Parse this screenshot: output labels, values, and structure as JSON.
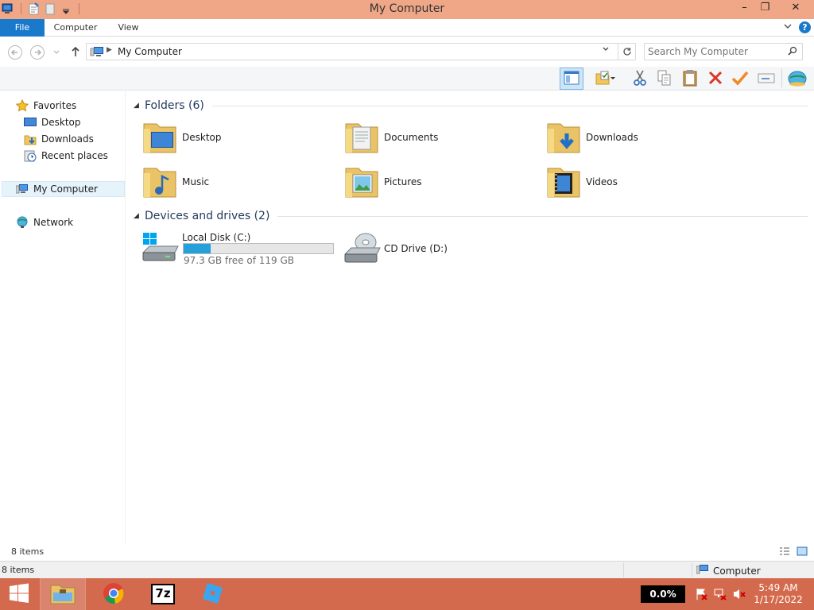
{
  "window": {
    "title": "My Computer",
    "controls": {
      "minimize": "–",
      "maximize": "❐",
      "close": "✕"
    }
  },
  "ribbon": {
    "tabs": [
      {
        "label": "File",
        "active": true
      },
      {
        "label": "Computer"
      },
      {
        "label": "View"
      }
    ],
    "help": "?"
  },
  "address": {
    "path": "My Computer",
    "search_placeholder": "Search My Computer"
  },
  "toolbar": {
    "buttons": [
      "layout-pane-icon",
      "properties-icon",
      "cut-icon",
      "copy-icon",
      "paste-icon",
      "delete-icon",
      "check-icon",
      "rename-icon",
      "network-globe-icon"
    ]
  },
  "nav": {
    "favorites": "Favorites",
    "items": [
      {
        "label": "Desktop",
        "icon": "desktop-icon"
      },
      {
        "label": "Downloads",
        "icon": "downloads-icon"
      },
      {
        "label": "Recent places",
        "icon": "recent-places-icon"
      }
    ],
    "computer": "My Computer",
    "network": "Network"
  },
  "content": {
    "folders_group": "Folders (6)",
    "folders": [
      {
        "label": "Desktop",
        "icon": "folder-desktop-icon"
      },
      {
        "label": "Documents",
        "icon": "folder-documents-icon"
      },
      {
        "label": "Downloads",
        "icon": "folder-downloads-icon"
      },
      {
        "label": "Music",
        "icon": "folder-music-icon"
      },
      {
        "label": "Pictures",
        "icon": "folder-pictures-icon"
      },
      {
        "label": "Videos",
        "icon": "folder-videos-icon"
      }
    ],
    "drives_group": "Devices and drives (2)",
    "drives": [
      {
        "label": "Local Disk (C:)",
        "info": "97.3 GB free of 119 GB",
        "used_fraction": 0.18,
        "icon": "hard-drive-icon"
      },
      {
        "label": "CD Drive (D:)",
        "icon": "cd-drive-icon"
      }
    ]
  },
  "status": {
    "item_count": "8 items"
  },
  "details": {
    "item_count": "8 items",
    "location": "Computer"
  },
  "taskbar": {
    "apps": [
      "start-icon",
      "file-explorer-icon",
      "chrome-icon",
      "7zip-icon",
      "roblox-icon"
    ],
    "sevenzip_label": "7z",
    "cpu": "0.0%",
    "time": "5:49 AM",
    "date": "1/17/2022"
  },
  "colors": {
    "titlebar": "#f0a787",
    "taskbar": "#d46a4d",
    "accent": "#1979ca",
    "drive_bar": "#26a0da"
  }
}
